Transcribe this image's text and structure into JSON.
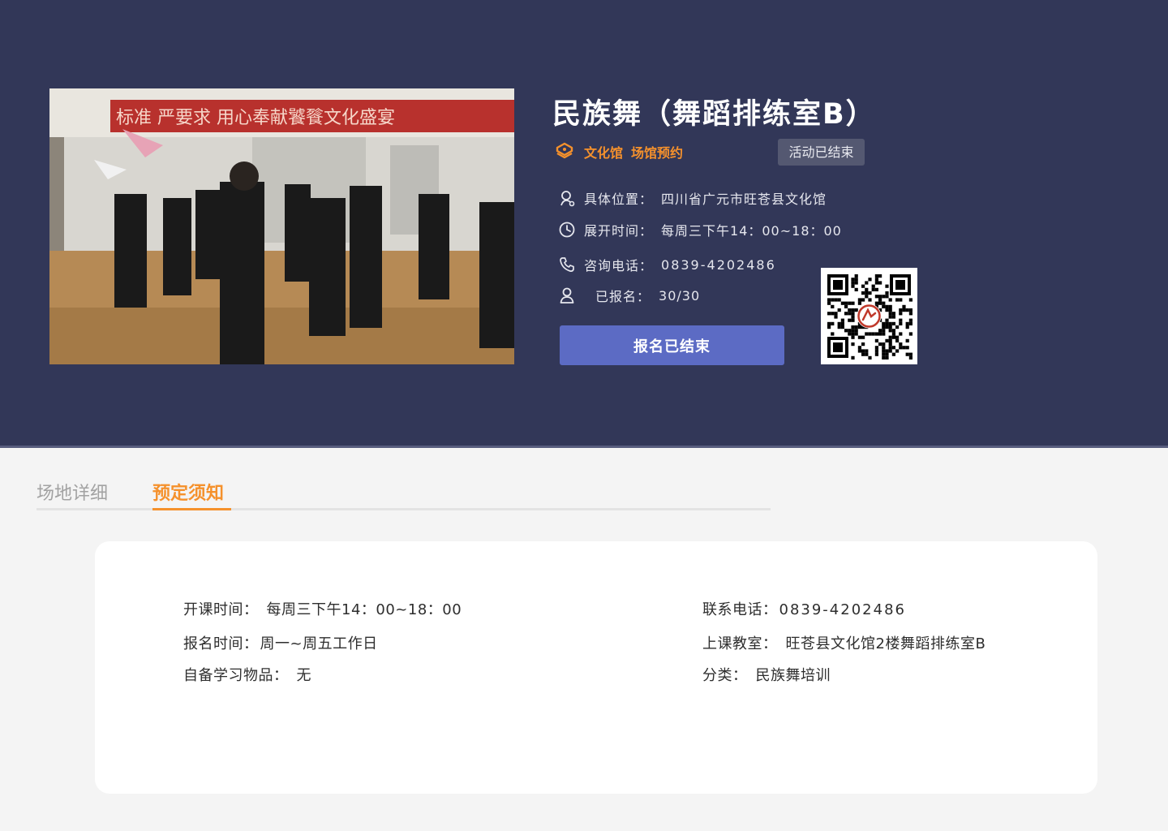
{
  "venue": {
    "title": "民族舞（舞蹈排练室B）",
    "tags": [
      "文化馆",
      "场馆预约"
    ],
    "status": "活动已结束",
    "photo_banner": "标准  严要求  用心奉献饕餮文化盛宴"
  },
  "info": {
    "location": {
      "label": "具体位置：",
      "value": "四川省广元市旺苍县文化馆"
    },
    "open_time": {
      "label": "展开时间：",
      "value": "每周三下午14：00~18：00"
    },
    "phone": {
      "label": "咨询电话：",
      "value": "0839-4202486"
    },
    "enrolled": {
      "label": "已报名：",
      "value": "30/30"
    }
  },
  "signup_button": "报名已结束",
  "tabs": [
    {
      "label": "场地详细",
      "active": false
    },
    {
      "label": "预定须知",
      "active": true
    }
  ],
  "notice": {
    "class_time": {
      "label": "开课时间：",
      "value": "每周三下午14：00~18：00"
    },
    "signup_time": {
      "label": "报名时间：",
      "value": "周一~周五工作日"
    },
    "supplies": {
      "label": "自备学习物品：",
      "value": "无"
    },
    "contact": {
      "label": "联系电话：",
      "value": "0839-4202486"
    },
    "classroom": {
      "label": "上课教室：",
      "value": "旺苍县文化馆2楼舞蹈排练室B"
    },
    "category": {
      "label": "分类：",
      "value": "民族舞培训"
    }
  },
  "colors": {
    "hero_bg": "#323758",
    "accent": "#f5912c",
    "button": "#5c6bc4",
    "badge": "#545871"
  },
  "icons": {
    "tag": "tag-icon",
    "location": "location-pin-icon",
    "time": "clock-icon",
    "phone": "phone-icon",
    "user": "user-icon"
  }
}
